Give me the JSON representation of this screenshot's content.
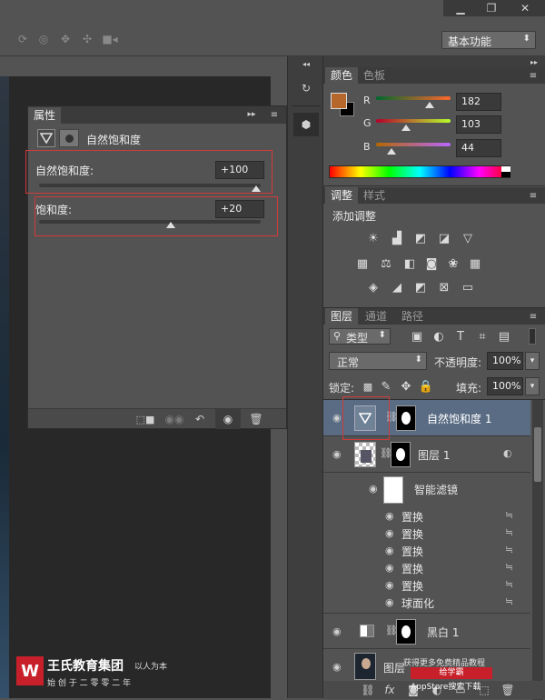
{
  "colors": {
    "panel_bg": "#535353",
    "dark_bg": "#282828",
    "selected_layer": "#596c84",
    "highlight_red": "#d23a3a",
    "swatch": "#b6672c"
  },
  "options_bar": {
    "workspace": "基本功能",
    "icons": [
      "rotate-3d-icon",
      "roll-3d-icon",
      "pan-3d-icon",
      "slide-3d-icon",
      "scale-3d-icon"
    ]
  },
  "properties": {
    "tab": "属性",
    "title": "自然饱和度",
    "vibrance_label": "自然饱和度:",
    "vibrance_value": "+100",
    "vibrance_level": 1.0,
    "saturation_label": "饱和度:",
    "saturation_value": "+20",
    "saturation_level": 0.6
  },
  "color_panel": {
    "tabs": [
      "颜色",
      "色板"
    ],
    "channels": [
      {
        "name": "R",
        "value": "182"
      },
      {
        "name": "G",
        "value": "103"
      },
      {
        "name": "B",
        "value": "44"
      }
    ]
  },
  "adjustments_panel": {
    "tabs": [
      "调整",
      "样式"
    ],
    "heading": "添加调整"
  },
  "layers_panel": {
    "tabs": [
      "图层",
      "通道",
      "路径"
    ],
    "filter_kind": "类型",
    "blend_mode": "正常",
    "opacity_label": "不透明度:",
    "opacity_value": "100%",
    "lock_label": "锁定:",
    "fill_label": "填充:",
    "fill_value": "100%",
    "layers": [
      {
        "name": "自然饱和度 1"
      },
      {
        "name": "图层 1"
      },
      {
        "name": "智能滤镜"
      },
      {
        "name": "黑白 1"
      },
      {
        "name": "图层"
      }
    ],
    "filters": [
      "置换",
      "置换",
      "置换",
      "置换",
      "置换",
      "球面化"
    ]
  },
  "watermark": {
    "brand": "王氏教育集团",
    "motto": "以人为本",
    "tagline": "始 创 于 二 零 零 二 年",
    "promo1": "获得更多免费精品教程",
    "promo2": "给学霸",
    "promo3": "AppStore搜索下载"
  }
}
